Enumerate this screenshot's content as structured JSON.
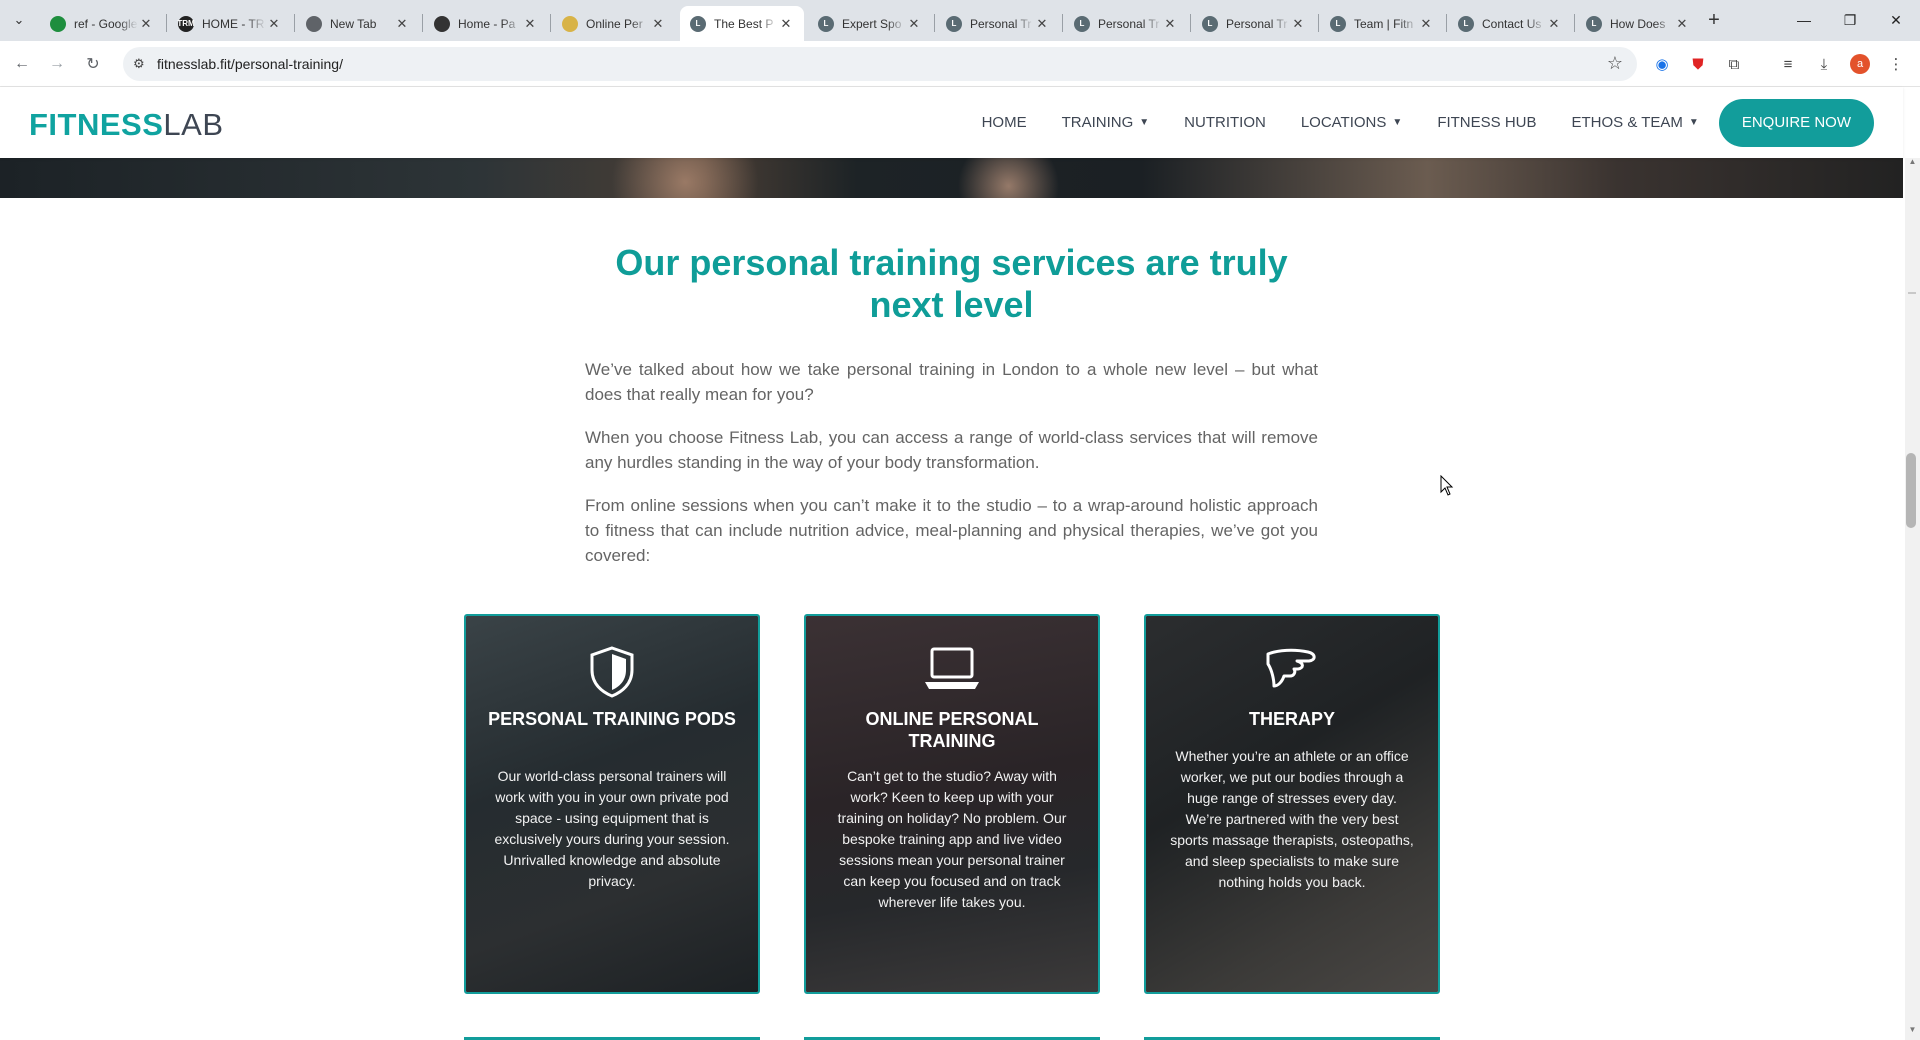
{
  "browser": {
    "tabs": [
      {
        "title": "ref - Google Sheets",
        "favicon_color": "#1e8e3e",
        "favicon_text": ""
      },
      {
        "title": "HOME - TRM",
        "favicon_color": "#222222",
        "favicon_text": "TRM"
      },
      {
        "title": "New Tab",
        "favicon_color": "#5f6368",
        "favicon_text": ""
      },
      {
        "title": "Home - Pa",
        "favicon_color": "#333333",
        "favicon_text": ""
      },
      {
        "title": "Online Per",
        "favicon_color": "#d8b347",
        "favicon_text": ""
      },
      {
        "title": "The Best P",
        "favicon_color": "#5a6b73",
        "favicon_text": "L",
        "active": true
      },
      {
        "title": "Expert Spo",
        "favicon_color": "#5a6b73",
        "favicon_text": "L"
      },
      {
        "title": "Personal Tr",
        "favicon_color": "#5a6b73",
        "favicon_text": "L"
      },
      {
        "title": "Personal Tr",
        "favicon_color": "#5a6b73",
        "favicon_text": "L"
      },
      {
        "title": "Personal Tr",
        "favicon_color": "#5a6b73",
        "favicon_text": "L"
      },
      {
        "title": "Team | Fitn",
        "favicon_color": "#5a6b73",
        "favicon_text": "L"
      },
      {
        "title": "Contact Us",
        "favicon_color": "#5a6b73",
        "favicon_text": "L"
      },
      {
        "title": "How Does",
        "favicon_color": "#5a6b73",
        "favicon_text": "L"
      }
    ],
    "url": "fitnesslab.fit/personal-training/",
    "profile_initial": "a"
  },
  "site": {
    "logo_bold": "FITNESS",
    "logo_light": "LAB",
    "nav": [
      {
        "label": "HOME",
        "dropdown": false
      },
      {
        "label": "TRAINING",
        "dropdown": true
      },
      {
        "label": "NUTRITION",
        "dropdown": false
      },
      {
        "label": "LOCATIONS",
        "dropdown": true
      },
      {
        "label": "FITNESS HUB",
        "dropdown": false
      },
      {
        "label": "ETHOS & TEAM",
        "dropdown": true
      }
    ],
    "cta": "ENQUIRE NOW",
    "accent": "#129d9b"
  },
  "content": {
    "heading": "Our personal training services are truly next level",
    "paragraphs": [
      "We’ve talked about how we take personal training in London to a whole new level – but what does that really mean for you?",
      "When you choose Fitness Lab, you can access a range of world-class services that will remove any hurdles standing in the way of your body transformation.",
      "From online sessions when you can’t make it to the studio – to a wrap-around holistic approach to fitness that can include nutrition advice, meal-planning and physical therapies, we’ve got you covered:"
    ],
    "cards": [
      {
        "icon": "shield-icon",
        "title": "PERSONAL TRAINING PODS",
        "body": "Our world-class personal trainers will work with you in your own private pod space - using equipment that is exclusively yours during your session. Unrivalled knowledge and absolute privacy."
      },
      {
        "icon": "laptop-icon",
        "title": "ONLINE PERSONAL TRAINING",
        "body": "Can’t get to the studio? Away with work? Keen to keep up with your training on holiday? No problem. Our bespoke training app and live video sessions mean your personal trainer can keep you focused and on track wherever life takes you."
      },
      {
        "icon": "hand-icon",
        "title": "THERAPY",
        "body": "Whether you’re an athlete or an office worker, we put our bodies through a huge range of stresses every day. We’re partnered with the very best sports massage therapists, osteopaths, and sleep specialists to make sure nothing holds you back."
      }
    ]
  }
}
